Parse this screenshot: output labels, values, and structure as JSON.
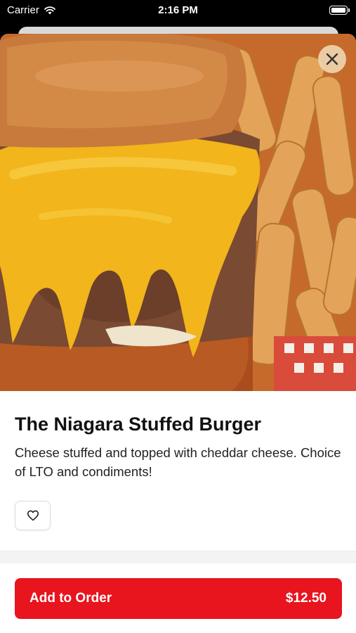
{
  "status_bar": {
    "carrier": "Carrier",
    "time": "2:16 PM"
  },
  "item": {
    "name": "The Niagara Stuffed Burger",
    "description": "Cheese stuffed and topped with cheddar cheese. Choice of LTO and condiments!",
    "image_alt": "Stuffed burger with melted cheddar cheese and fries"
  },
  "icons": {
    "close": "close-icon",
    "favorite": "heart-icon",
    "wifi": "wifi-icon",
    "battery": "battery-icon"
  },
  "actions": {
    "add_label": "Add to Order",
    "price": "$12.50"
  },
  "colors": {
    "accent": "#e8141e",
    "close_button": "#eed6b0"
  }
}
